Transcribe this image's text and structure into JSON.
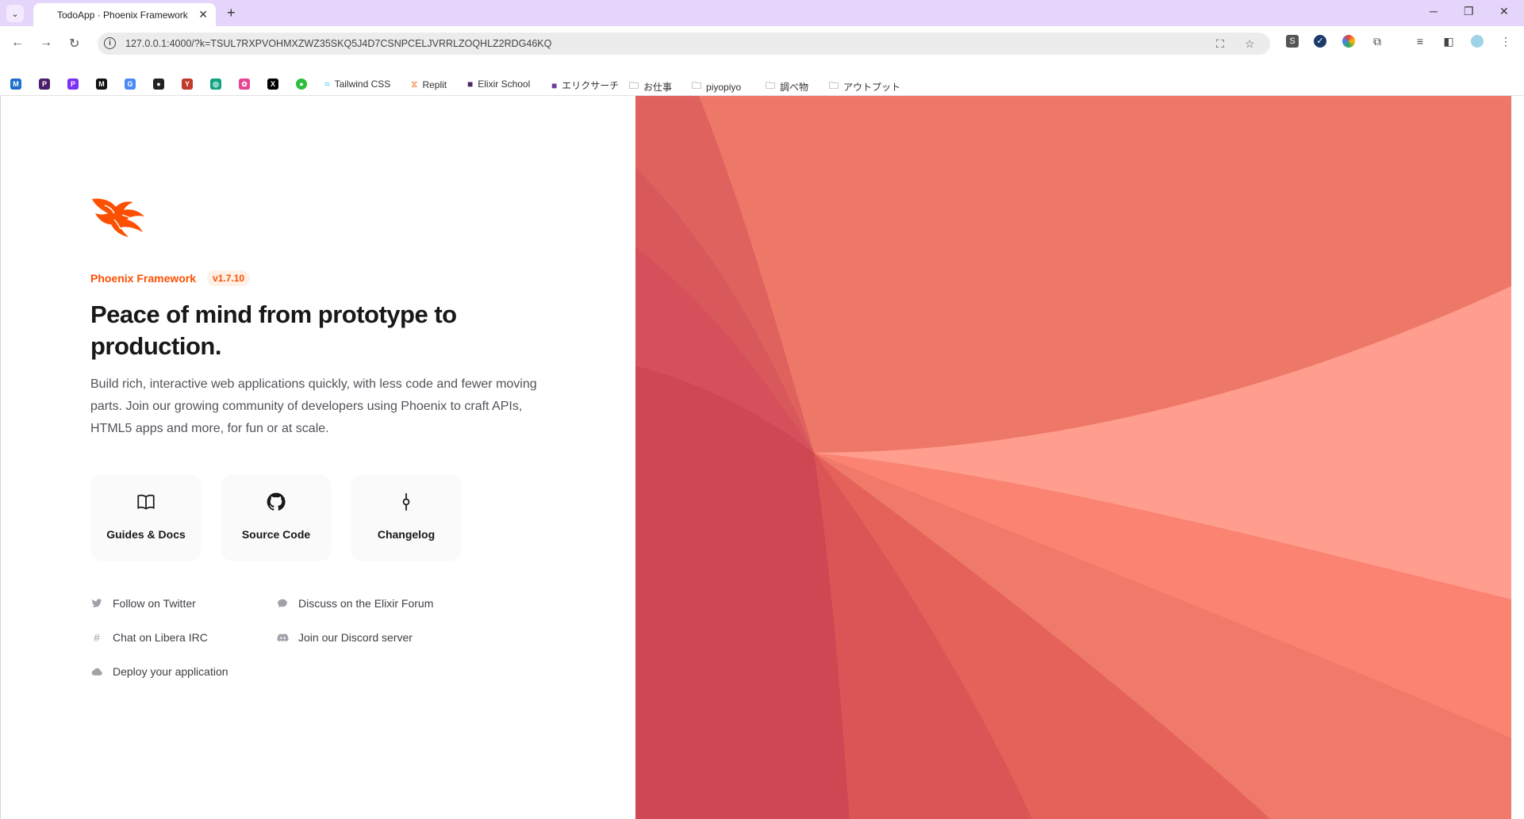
{
  "browser": {
    "tab_title": "TodoApp · Phoenix Framework",
    "url": "127.0.0.1:4000/?k=TSUL7RXPVOHMXZWZ35SKQ5J4D7CSNPCELJVRRLZOQHLZ2RDG46KQ",
    "bookmarks": [
      {
        "label": "Tailwind CSS",
        "icon": "tailwind-icon"
      },
      {
        "label": "Replit",
        "icon": "replit-icon"
      },
      {
        "label": "Elixir School",
        "icon": "elixir-school-icon"
      },
      {
        "label": "エリクサーチ",
        "icon": "elixirsearch-icon"
      },
      {
        "label": "お仕事",
        "icon": "folder-icon"
      },
      {
        "label": "piyopiyo",
        "icon": "folder-icon"
      },
      {
        "label": "調べ物",
        "icon": "folder-icon"
      },
      {
        "label": "アウトプット",
        "icon": "folder-icon"
      }
    ]
  },
  "hero": {
    "brand_name": "Phoenix Framework",
    "version": "v1.7.10",
    "headline": "Peace of mind from prototype to production.",
    "lead": "Build rich, interactive web applications quickly, with less code and fewer moving parts. Join our growing community of developers using Phoenix to craft APIs, HTML5 apps and more, for fun or at scale."
  },
  "cards": [
    {
      "label": "Guides & Docs",
      "icon": "book-icon"
    },
    {
      "label": "Source Code",
      "icon": "github-icon"
    },
    {
      "label": "Changelog",
      "icon": "commit-icon"
    }
  ],
  "links": [
    {
      "label": "Follow on Twitter",
      "icon": "twitter-icon"
    },
    {
      "label": "Discuss on the Elixir Forum",
      "icon": "chat-bubble-icon"
    },
    {
      "label": "Chat on Libera IRC",
      "icon": "hash-icon"
    },
    {
      "label": "Join our Discord server",
      "icon": "discord-icon"
    },
    {
      "label": "Deploy your application",
      "icon": "cloud-icon"
    }
  ],
  "colors": {
    "brand": "#fd4f00",
    "tab_strip": "#e6d5fb"
  }
}
